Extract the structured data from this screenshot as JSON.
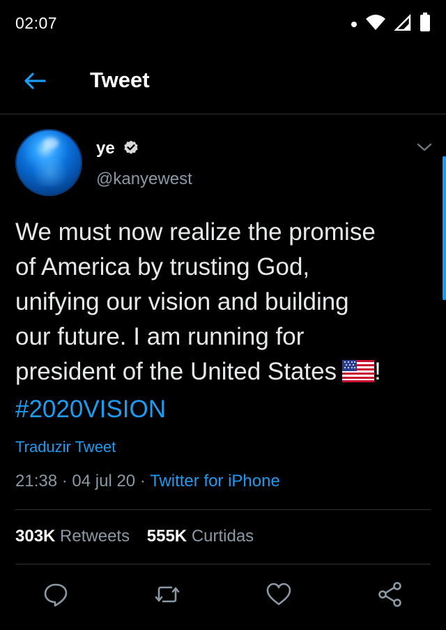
{
  "status_bar": {
    "time": "02:07",
    "icons": [
      "notification-dot-icon",
      "wifi-icon",
      "cell-signal-icon",
      "battery-icon"
    ]
  },
  "header": {
    "title": "Tweet",
    "back_icon": "back-arrow-icon"
  },
  "tweet": {
    "author": {
      "display_name": "ye",
      "handle": "@kanyewest",
      "verified": true
    },
    "text_lines": [
      "We must now realize the promise",
      "of America by trusting God,",
      "unifying our vision and building",
      "our future. I am running for",
      "president of the United States"
    ],
    "text_suffix": "!",
    "hashtag": "#2020VISION",
    "translate_label": "Traduzir Tweet",
    "time": "21:38",
    "separator": "·",
    "date": "04 jul 20",
    "source": "Twitter for iPhone",
    "stats": {
      "retweets_count": "303K",
      "retweets_label": "Retweets",
      "likes_count": "555K",
      "likes_label": "Curtidas"
    },
    "actions": [
      "reply-icon",
      "retweet-icon",
      "like-icon",
      "share-icon"
    ]
  },
  "colors": {
    "background": "#000000",
    "accent": "#1d9bf0",
    "secondary_text": "#8b98a5",
    "divider": "#2f3336"
  }
}
